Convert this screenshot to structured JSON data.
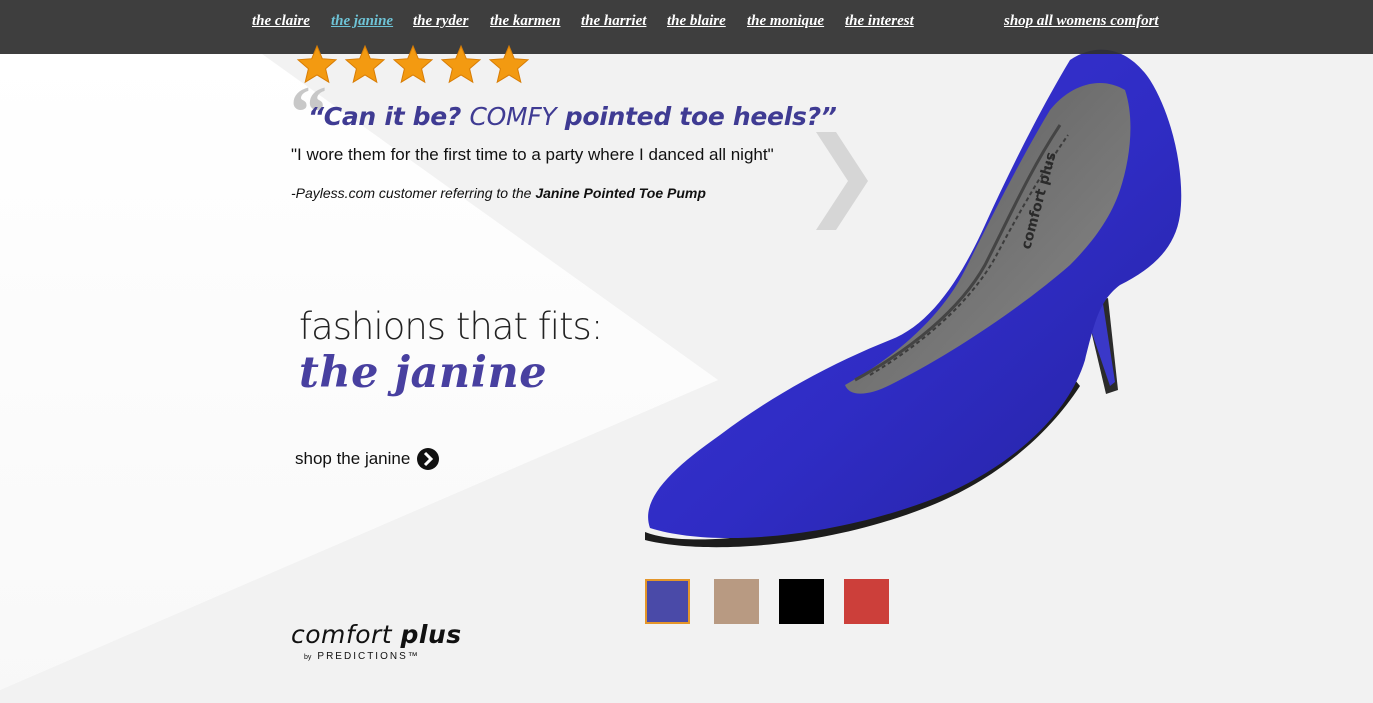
{
  "nav": {
    "links": [
      "the claire",
      "the janine",
      "the ryder",
      "the karmen",
      "the harriet",
      "the blaire",
      "the monique",
      "the interest"
    ],
    "active": "the janine",
    "shop_all": "shop all womens comfort"
  },
  "rating": {
    "stars": 5,
    "max": 5,
    "icon": "star-icon",
    "color": "#f39a11"
  },
  "review": {
    "quote_mark": "“",
    "headline_part1": "“Can it be? ",
    "headline_part2": "COMFY",
    "headline_part3": " pointed toe heels?”",
    "text": "\"I wore them for the first time to a party where I danced all night\"",
    "attribution_prefix": "-Payless.com customer referring to the ",
    "attribution_product": "Janine Pointed Toe Pump"
  },
  "hero": {
    "tagline": "fashions that fits:",
    "product_name": "the janine",
    "shop_label": "shop the janine",
    "next_icon": "chevron-right-icon"
  },
  "colors": {
    "accent": "#3f3b93",
    "nav_active": "#6ec3d6",
    "swatches": [
      "#4a4aa8",
      "#b89a82",
      "#000000",
      "#cc3f3a"
    ],
    "selected_swatch_border": "#e4962a"
  },
  "brand": {
    "name_light": "comfort ",
    "name_bold": "plus",
    "by": "by",
    "sub": "PREDICTIONS™"
  }
}
